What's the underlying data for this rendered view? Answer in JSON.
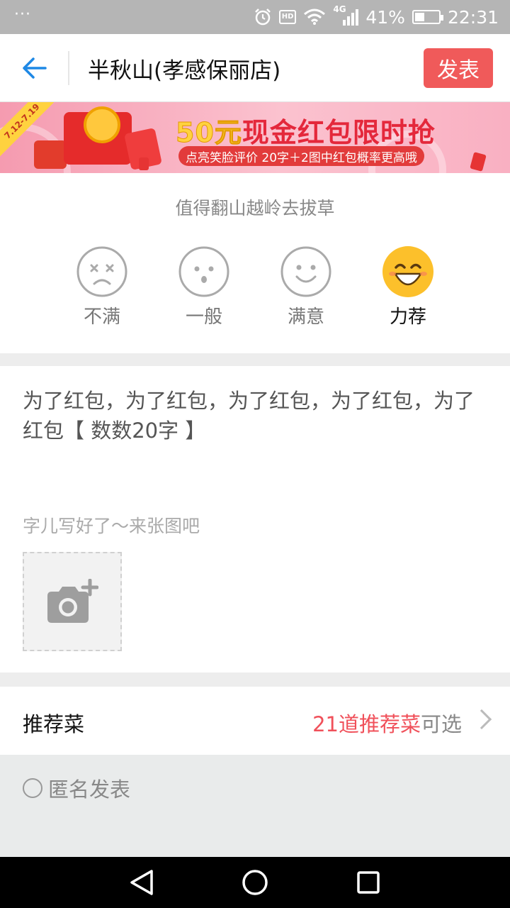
{
  "status_bar": {
    "time": "22:31",
    "battery": "41%",
    "battery_level": 0.41,
    "network": "4G",
    "hd_badge": "HD",
    "icons": [
      "more-dots-icon",
      "alarm-icon",
      "hd-icon",
      "wifi-icon",
      "signal-icon",
      "battery-icon"
    ]
  },
  "header": {
    "title": "半秋山(孝感保丽店)",
    "publish_label": "发表",
    "back_icon": "back-arrow-icon"
  },
  "banner": {
    "date_range": "7.12-7.19",
    "headline_amount": "50元",
    "headline_rest": "现金红包限时抢",
    "subline": "点亮笑脸评价 20字＋2图中红包概率更高哦"
  },
  "rating": {
    "hint": "值得翻山越岭去拔草",
    "options": [
      {
        "label": "不满",
        "icon": "unhappy-face-icon"
      },
      {
        "label": "一般",
        "icon": "neutral-face-icon"
      },
      {
        "label": "满意",
        "icon": "smile-face-icon"
      },
      {
        "label": "力荐",
        "icon": "big-grin-face-icon"
      }
    ],
    "selected": "力荐"
  },
  "review": {
    "text": "为了红包，为了红包，为了红包，为了红包，为了红包【 数数20字 】",
    "photo_hint": "字儿写好了～来张图吧",
    "add_photo_icon": "camera-plus-icon"
  },
  "dishes": {
    "label": "推荐菜",
    "count_text": "21道推荐菜",
    "suffix": "可选"
  },
  "anonymous": {
    "label": "匿名发表"
  },
  "colors": {
    "accent_blue": "#1e88e5",
    "publish_red": "#f05a5a",
    "face_yellow": "#fcc02b"
  }
}
